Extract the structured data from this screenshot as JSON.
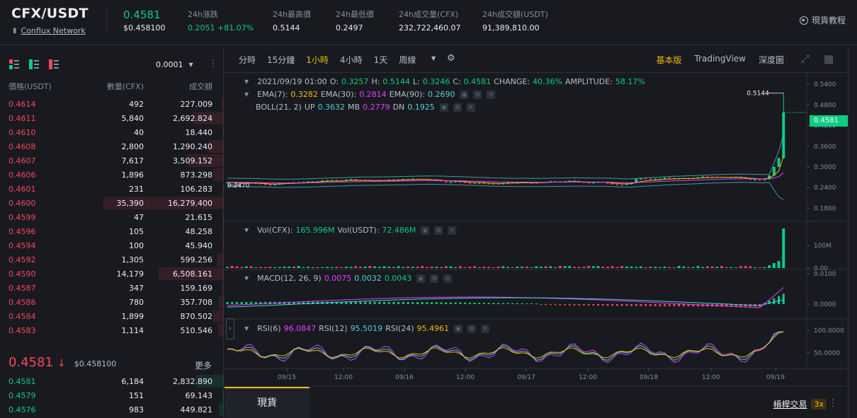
{
  "header": {
    "pair": "CFX/USDT",
    "network_link": "Conflux Network",
    "last_price": "0.4581",
    "last_price_usd": "$0.458100",
    "stats": [
      {
        "label": "24h漲跌",
        "value": "0.2051 +81.07%",
        "green": true
      },
      {
        "label": "24h最高價",
        "value": "0.5144",
        "green": false
      },
      {
        "label": "24h最低價",
        "value": "0.2497",
        "green": false
      },
      {
        "label": "24h成交量(CFX)",
        "value": "232,722,460.07",
        "green": false
      },
      {
        "label": "24h成交額(USDT)",
        "value": "91,389,810.00",
        "green": false
      }
    ],
    "tutorial": "現貨教程"
  },
  "orderbook": {
    "precision": "0.0001",
    "columns": {
      "price": "價格(USDT)",
      "qty": "數量(CFX)",
      "total": "成交額"
    },
    "asks": [
      {
        "price": "0.4614",
        "qty": "492",
        "total": "227.009",
        "depth": 0.02
      },
      {
        "price": "0.4611",
        "qty": "5,840",
        "total": "2,692.824",
        "depth": 0.26
      },
      {
        "price": "0.4610",
        "qty": "40",
        "total": "18.440",
        "depth": 0.01
      },
      {
        "price": "0.4608",
        "qty": "2,800",
        "total": "1,290.240",
        "depth": 0.13
      },
      {
        "price": "0.4607",
        "qty": "7,617",
        "total": "3,509.152",
        "depth": 0.3
      },
      {
        "price": "0.4606",
        "qty": "1,896",
        "total": "873.298",
        "depth": 0.09
      },
      {
        "price": "0.4601",
        "qty": "231",
        "total": "106.283",
        "depth": 0.01
      },
      {
        "price": "0.4600",
        "qty": "35,390",
        "total": "16,279.400",
        "depth": 1.0
      },
      {
        "price": "0.4599",
        "qty": "47",
        "total": "21.615",
        "depth": 0.01
      },
      {
        "price": "0.4596",
        "qty": "105",
        "total": "48.258",
        "depth": 0.01
      },
      {
        "price": "0.4594",
        "qty": "100",
        "total": "45.940",
        "depth": 0.01
      },
      {
        "price": "0.4592",
        "qty": "1,305",
        "total": "599.256",
        "depth": 0.06
      },
      {
        "price": "0.4590",
        "qty": "14,179",
        "total": "6,508.161",
        "depth": 0.54
      },
      {
        "price": "0.4587",
        "qty": "347",
        "total": "159.169",
        "depth": 0.02
      },
      {
        "price": "0.4586",
        "qty": "780",
        "total": "357.708",
        "depth": 0.04
      },
      {
        "price": "0.4584",
        "qty": "1,899",
        "total": "870.502",
        "depth": 0.09
      },
      {
        "price": "0.4583",
        "qty": "1,114",
        "total": "510.546",
        "depth": 0.05
      }
    ],
    "mid_price": "0.4581",
    "mid_arrow": "↓",
    "mid_usd": "$0.458100",
    "more": "更多",
    "bids": [
      {
        "price": "0.4581",
        "qty": "6,184",
        "total": "2,832.890",
        "depth": 0.23
      },
      {
        "price": "0.4579",
        "qty": "151",
        "total": "69.143",
        "depth": 0.01
      },
      {
        "price": "0.4576",
        "qty": "983",
        "total": "449.821",
        "depth": 0.04
      }
    ]
  },
  "chart": {
    "intervals": [
      "分時",
      "15分鐘",
      "1小時",
      "4小時",
      "1天",
      "周線"
    ],
    "active_interval": "1小時",
    "views": [
      "基本版",
      "TradingView",
      "深度圖"
    ],
    "active_view": "基本版",
    "ohlc": {
      "date": "2021/09/19 01:00",
      "o_label": "O:",
      "o": "0.3257",
      "h_label": "H:",
      "h": "0.5144",
      "l_label": "L:",
      "l": "0.3246",
      "c_label": "C:",
      "c": "0.4581",
      "change_label": "CHANGE:",
      "change": "40.36%",
      "amp_label": "AMPLITUDE:",
      "amp": "58.17%"
    },
    "ema": {
      "l7": "EMA(7):",
      "v7": "0.3282",
      "l30": "EMA(30):",
      "v30": "0.2814",
      "l90": "EMA(90):",
      "v90": "0.2690"
    },
    "boll": {
      "label": "BOLL(21, 2)",
      "up_l": "UP",
      "up": "0.3632",
      "mb_l": "MB",
      "mb": "0.2779",
      "dn_l": "DN",
      "dn": "0.1925"
    },
    "vol": {
      "l1": "Vol(CFX):",
      "v1": "165.996M",
      "l2": "Vol(USDT):",
      "v2": "72.486M"
    },
    "macd": {
      "label": "MACD(12, 26, 9)",
      "v1": "0.0075",
      "v2": "0.0032",
      "v3": "0.0043"
    },
    "rsi": {
      "l6": "RSI(6)",
      "v6": "96.0847",
      "l12": "RSI(12)",
      "v12": "95.5019",
      "l24": "RSI(24)",
      "v24": "95.4961"
    },
    "price_tag": "0.4581",
    "high_marker": "0.5144",
    "low_marker": "0.2470",
    "price_axis": [
      "0.5400",
      "0.4800",
      "0.4200",
      "0.3600",
      "0.3000",
      "0.2400",
      "0.1800"
    ],
    "vol_axis": [
      "100M",
      "0.00"
    ],
    "macd_axis": [
      "0.0100",
      "0.0000"
    ],
    "rsi_axis": [
      "100.0000",
      "50.0000"
    ],
    "time_axis": [
      "09/15",
      "12:00",
      "09/16",
      "12:00",
      "09/17",
      "12:00",
      "09/18",
      "12:00",
      "09/19"
    ]
  },
  "bottom": {
    "spot_tab": "現貨",
    "leverage_link": "槓桿交易",
    "leverage_badge": "3x"
  },
  "colors": {
    "up": "#0ecb81",
    "down": "#f6465d",
    "accent": "#f0b90b"
  }
}
